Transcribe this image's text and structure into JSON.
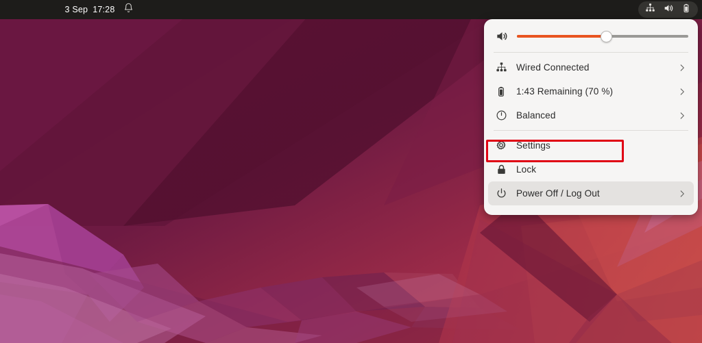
{
  "desktop": {
    "os": "Ubuntu",
    "wallpaper_name": "jammy-jellyfish-polygon-wallpaper"
  },
  "topbar": {
    "date": "3 Sep",
    "time": "17:28",
    "notifications_icon": "bell-icon",
    "indicators": [
      {
        "name": "wired-network-icon",
        "label": "Wired network"
      },
      {
        "name": "volume-icon",
        "label": "Volume"
      },
      {
        "name": "battery-icon",
        "label": "Battery"
      }
    ]
  },
  "system_menu": {
    "volume": {
      "icon": "volume-icon",
      "value_percent": 52,
      "fill_color": "#e95420",
      "track_color": "#9a9996"
    },
    "items": [
      {
        "id": "wired-connected",
        "icon": "network-wired-icon",
        "label": "Wired Connected",
        "has_chevron": true,
        "hovered": false
      },
      {
        "id": "battery-status",
        "icon": "battery-icon",
        "label": "1:43 Remaining (70 %)",
        "has_chevron": true,
        "hovered": false
      },
      {
        "id": "power-profile",
        "icon": "power-profile-balanced-icon",
        "label": "Balanced",
        "has_chevron": true,
        "hovered": false
      },
      {
        "id": "settings",
        "icon": "gear-icon",
        "label": "Settings",
        "has_chevron": false,
        "hovered": false
      },
      {
        "id": "lock",
        "icon": "lock-icon",
        "label": "Lock",
        "has_chevron": false,
        "hovered": false
      },
      {
        "id": "power-off-log-out",
        "icon": "power-icon",
        "label": "Power Off / Log Out",
        "has_chevron": true,
        "hovered": true
      }
    ]
  },
  "annotation": {
    "type": "highlight-rectangle",
    "target": "settings",
    "color": "#e00014"
  }
}
